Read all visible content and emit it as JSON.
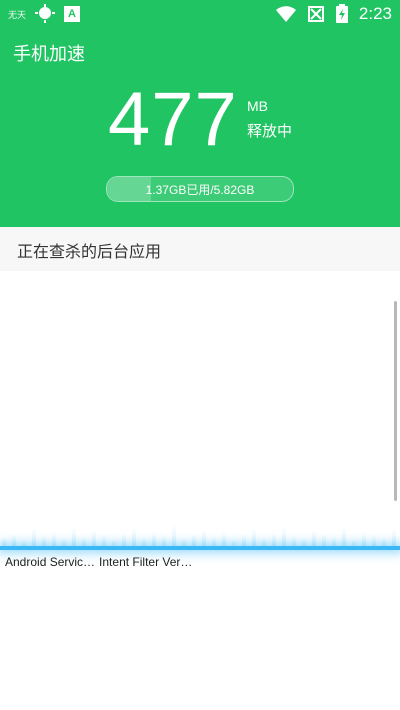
{
  "status_bar": {
    "carrier": "无天",
    "app_badge": "A",
    "time": "2:23",
    "icons": [
      "weather-sun-icon",
      "app-badge-icon",
      "wifi-icon",
      "no-sim-icon",
      "battery-charging-icon"
    ]
  },
  "header": {
    "title": "手机加速",
    "amount": "477",
    "unit": "MB",
    "status": "释放中",
    "memory": {
      "text": "1.37GB已用/5.82GB",
      "used_gb": 1.37,
      "total_gb": 5.82
    },
    "accent_color": "#21C463"
  },
  "section": {
    "title": "正在查杀的后台应用"
  },
  "scan": {
    "apps": [
      "Android Servic…",
      "Intent Filter Ver…"
    ],
    "scan_color": "#39B8F5"
  }
}
